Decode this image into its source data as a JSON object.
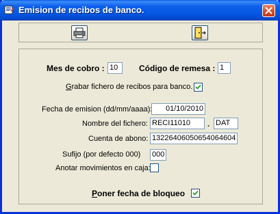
{
  "window": {
    "title": "Emision de recibos de banco.",
    "title_icon": "report-icon",
    "close_icon": "close-icon"
  },
  "toolbar": {
    "print_icon": "printer-icon",
    "exit_icon": "exit-door-icon"
  },
  "form": {
    "mes_cobro_label": "Mes de cobro :",
    "mes_cobro_value": "10",
    "codigo_remesa_label": "Código de remesa :",
    "codigo_remesa_value": "1",
    "grabar_label": "Grabar fichero de recibos para banco.",
    "grabar_checked": true,
    "fecha_emision_label": "Fecha de emision (dd/mm/aaaa):",
    "fecha_emision_value": "01/10/2010",
    "nombre_fichero_label": "Nombre del fichero:",
    "nombre_fichero_value": "RECI11010",
    "extension_separator": ".",
    "extension_value": "DAT",
    "cuenta_abono_label": "Cuenta de abono:",
    "cuenta_abono_value": "13226406050654064604",
    "sufijo_label": "Sufijo (por defecto 000)",
    "sufijo_value": "000",
    "anotar_label": "Anotar movimientos en caja:",
    "anotar_checked": false,
    "poner_fecha_label": "Poner fecha de bloqueo",
    "poner_fecha_checked": true
  }
}
